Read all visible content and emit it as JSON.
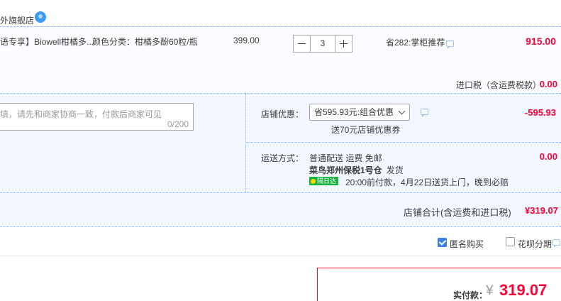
{
  "shop": {
    "name": "外旗舰店",
    "wangwang_icon": "wangwang-chat-icon"
  },
  "item": {
    "title": "语专享】Biowell柑橘多...",
    "sku": "颜色分类：柑橘多酚60粒/瓶",
    "price": "399.00",
    "quantity": "3",
    "promo": "省282:掌柜推荐",
    "total": "915.00",
    "tax_label": "进口税（含运费税款）",
    "tax_value": "0.00"
  },
  "message": {
    "placeholder": "填，请先和商家协商一致，付款后商家可见",
    "counter": "0/200"
  },
  "discount": {
    "label": "店铺优惠：",
    "selected_option": "省595.93元:组合优惠",
    "hint": "送70元店铺优惠券",
    "value": "-595.93"
  },
  "shipping": {
    "label": "运送方式：",
    "method": "普通配送 运费 免邮",
    "warehouse": "菜鸟郑州保税1号仓",
    "send": "发货",
    "badge": "隔日达",
    "eta": "20:00前付款，4月22日送货上门，晚到必赔",
    "fee": "0.00"
  },
  "summary": {
    "label": "店铺合计(含运费和进口税)",
    "value": "¥319.07"
  },
  "options": {
    "anonymous_label": "匿名购买",
    "anonymous_checked": true,
    "huabei_label": "花呗分期",
    "huabei_checked": false
  },
  "payment": {
    "label": "实付款：",
    "currency": "¥",
    "amount": "319.07"
  },
  "colors": {
    "price_red": "#ff0036",
    "divider_blue": "#80b2ff",
    "panel_bg": "#f2f7ff",
    "checkbox_blue": "#3b80ea",
    "badge_green": "#16b341"
  }
}
